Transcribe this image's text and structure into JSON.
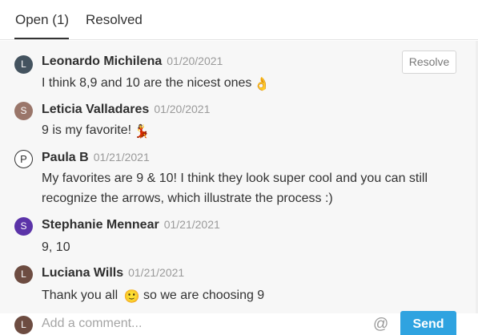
{
  "tabs": {
    "open_label": "Open (1)",
    "resolved_label": "Resolved"
  },
  "thread": {
    "resolve_label": "Resolve",
    "comments": [
      {
        "initial": "L",
        "author": "Leonardo Michilena",
        "date": "01/20/2021",
        "text": "I think 8,9 and 10 are the nicest ones",
        "emoji": "👌",
        "avatar_color": "#44535f"
      },
      {
        "initial": "S",
        "author": "Leticia Valladares",
        "date": "01/20/2021",
        "text": "9 is my favorite!",
        "emoji": "💃",
        "avatar_color": "#9a766a"
      },
      {
        "initial": "P",
        "author": "Paula B",
        "date": "01/21/2021",
        "text": "My favorites are 9 & 10! I think they look super cool and you can still recognize the arrows, which illustrate the process :)",
        "avatar_color": "#ffffff"
      },
      {
        "initial": "S",
        "author": "Stephanie Mennear",
        "date": "01/21/2021",
        "text": "9, 10",
        "avatar_color": "#5b33a8"
      },
      {
        "initial": "L",
        "author": "Luciana Wills",
        "date": "01/21/2021",
        "text_before": "Thank you all",
        "emoji": "🙂",
        "text_after": "so we are choosing 9",
        "avatar_color": "#6d4c41"
      }
    ]
  },
  "compose": {
    "initial": "L",
    "placeholder": "Add a comment...",
    "at_symbol": "@",
    "send_label": "Send"
  },
  "icons": {
    "mention": "at-sign-icon",
    "hand_emoji": "ok-hand-icon",
    "dancer_emoji": "dancer-icon",
    "smile_emoji": "smiling-face-icon"
  }
}
